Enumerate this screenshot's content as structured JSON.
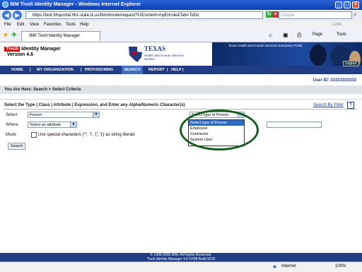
{
  "window": {
    "title": "IBM Tivoli Identity Manager - Windows Internet Explorer"
  },
  "address_bar": {
    "url": "https://test.hhsportal.hhs.state.tx.us/itim/enrole/request?UIContext=myEnrole&Tab=ToDo",
    "search_placeholder": "Google"
  },
  "menubar": {
    "items": [
      "File",
      "Edit",
      "View",
      "Favorites",
      "Tools",
      "Help"
    ]
  },
  "tab": {
    "label": "IBM Tivoli Identity Manager"
  },
  "toolbar": {
    "page_label": "Page",
    "tools_label": "Tools"
  },
  "banner": {
    "product": "Tivoli",
    "product_suffix": "Identity Manager",
    "version": "Version 4.6",
    "texas_title": "TEXAS",
    "texas_subtitle": "Health and Human Services System",
    "portal_title": "Texas Health and Human Services Enterprise Portal"
  },
  "nav": {
    "items": [
      "HOME",
      "MY ORGANIZATION",
      "PROVISIONING",
      "SEARCH",
      "REPORT",
      "HELP"
    ],
    "active": "SEARCH",
    "logout": "Logout"
  },
  "user": {
    "label": "User ID: 33333333333"
  },
  "breadcrumb": "You Are Here: Search > Select Criteria",
  "instructions": "Select the Type | Class | Attribute | Expression, and Enter any Alpha/Numeric Character(s)",
  "search_by_filter": "Search By Filter",
  "form": {
    "select_label": "Select",
    "select_value": "Person",
    "type_value": "Select type of Person",
    "where_label": "Where",
    "where_value": "Select an attribute",
    "mode_label": "Mode",
    "mode_checkbox_text": "Use special characters ('*', '\\', '(', ')') as string literals",
    "search_button": "Search"
  },
  "dropdown": {
    "options": [
      "Select type of Person",
      "Employee",
      "Contractor",
      "System User"
    ],
    "highlighted": 0
  },
  "footer": {
    "copyright": "© 1999-2005 IBM. All Rights Reserved.",
    "build": "Tivoli Identity Manager 4.6 FP98 Build 5539"
  },
  "statusbar": {
    "zone": "Internet",
    "zoom": "100%"
  },
  "colors": {
    "nav_bg": "#1f3c85",
    "highlight": "#316ac5",
    "annotation_circle": "#155c1d"
  }
}
